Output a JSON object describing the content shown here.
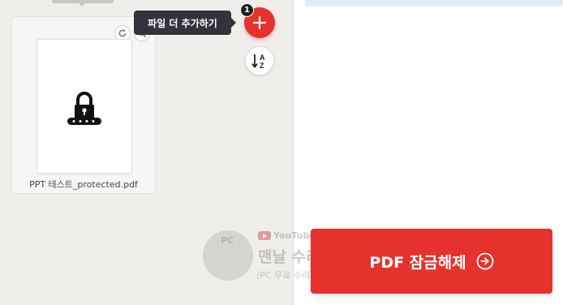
{
  "file_card": {
    "file_name": "PPT 테스트_protected.pdf",
    "rotate_icon": "rotate-icon",
    "zoom_icon": "zoom-icon",
    "lock_icon": "lock-icon"
  },
  "toolbar": {
    "add_tooltip": "파일 더 추가하기",
    "file_count_badge": "1",
    "add_icon": "plus-icon",
    "sort_icon": "sort-az-icon"
  },
  "watermark": {
    "logo_text": "PC",
    "youtube_label": "YouTube",
    "channel_name": "맨날 수리야",
    "subtitle": "(PC 무료 수리, 꿀팁)"
  },
  "action": {
    "unlock_label": "PDF 잠금해제",
    "arrow_icon": "arrow-right-circle-icon"
  },
  "colors": {
    "accent": "#e5322d",
    "pane_bg": "#f0eeeb",
    "tooltip_bg": "#33333b",
    "info_strip": "#dfeef7"
  }
}
